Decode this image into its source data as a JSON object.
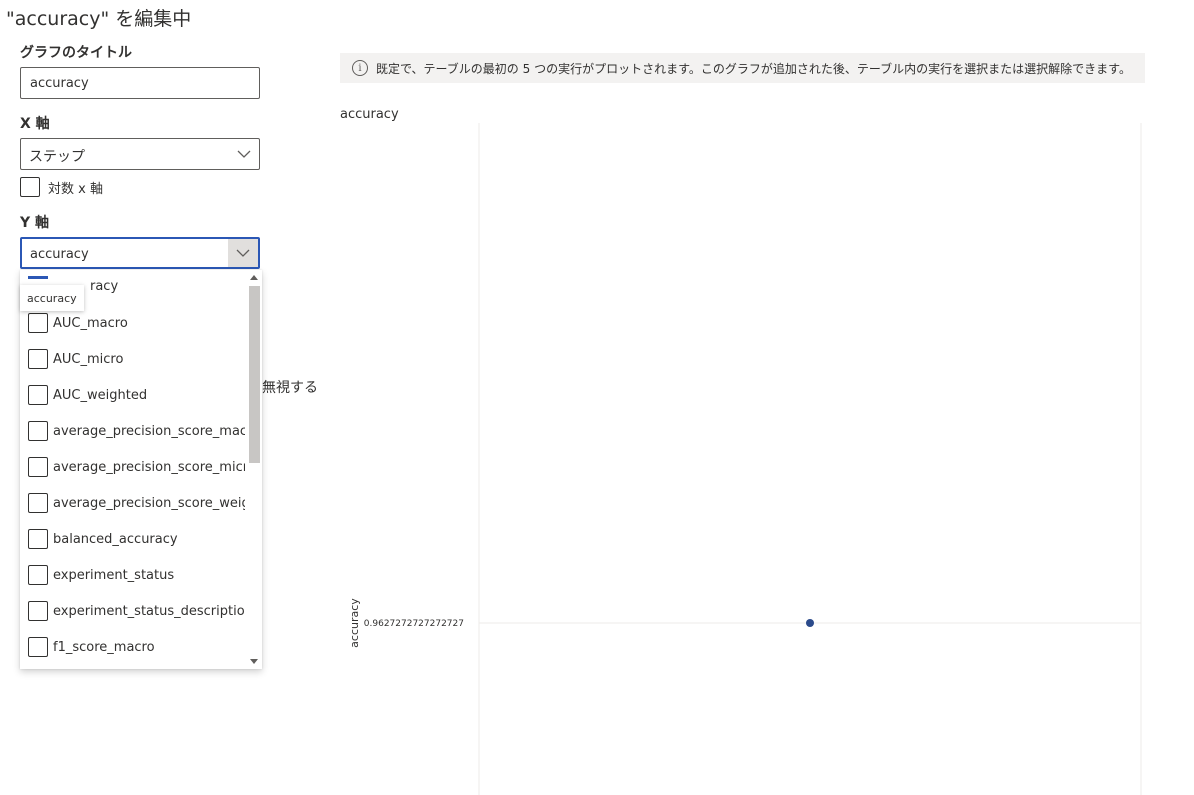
{
  "page_title": "\"accuracy\" を編集中",
  "form": {
    "graph_title_label": "グラフのタイトル",
    "graph_title_value": "accuracy",
    "x_axis_label": "X 軸",
    "x_axis_value": "ステップ",
    "log_x_label": "対数 x 軸",
    "y_axis_label": "Y 軸",
    "y_axis_value": "accuracy",
    "ignore_text": "無視する"
  },
  "dropdown": {
    "tooltip": "accuracy",
    "first_item_partial": "racy",
    "items": [
      "AUC_macro",
      "AUC_micro",
      "AUC_weighted",
      "average_precision_score_macro",
      "average_precision_score_micro",
      "average_precision_score_weighted",
      "balanced_accuracy",
      "experiment_status",
      "experiment_status_description",
      "f1_score_macro"
    ]
  },
  "info": {
    "icon": "info-icon",
    "text": "既定で、テーブルの最初の 5 つの実行がプロットされます。このグラフが追加された後、テーブル内の実行を選択または選択解除できます。"
  },
  "chart_data": {
    "type": "scatter",
    "title": "accuracy",
    "ylabel": "accuracy",
    "xlabel": "",
    "y_tick_labels": [
      "0.9627272727272727"
    ],
    "series": [
      {
        "points": [
          {
            "x": 0,
            "y": 0.9627272727272727
          }
        ]
      }
    ],
    "point_color": "#2b4a8b",
    "grid": true
  }
}
